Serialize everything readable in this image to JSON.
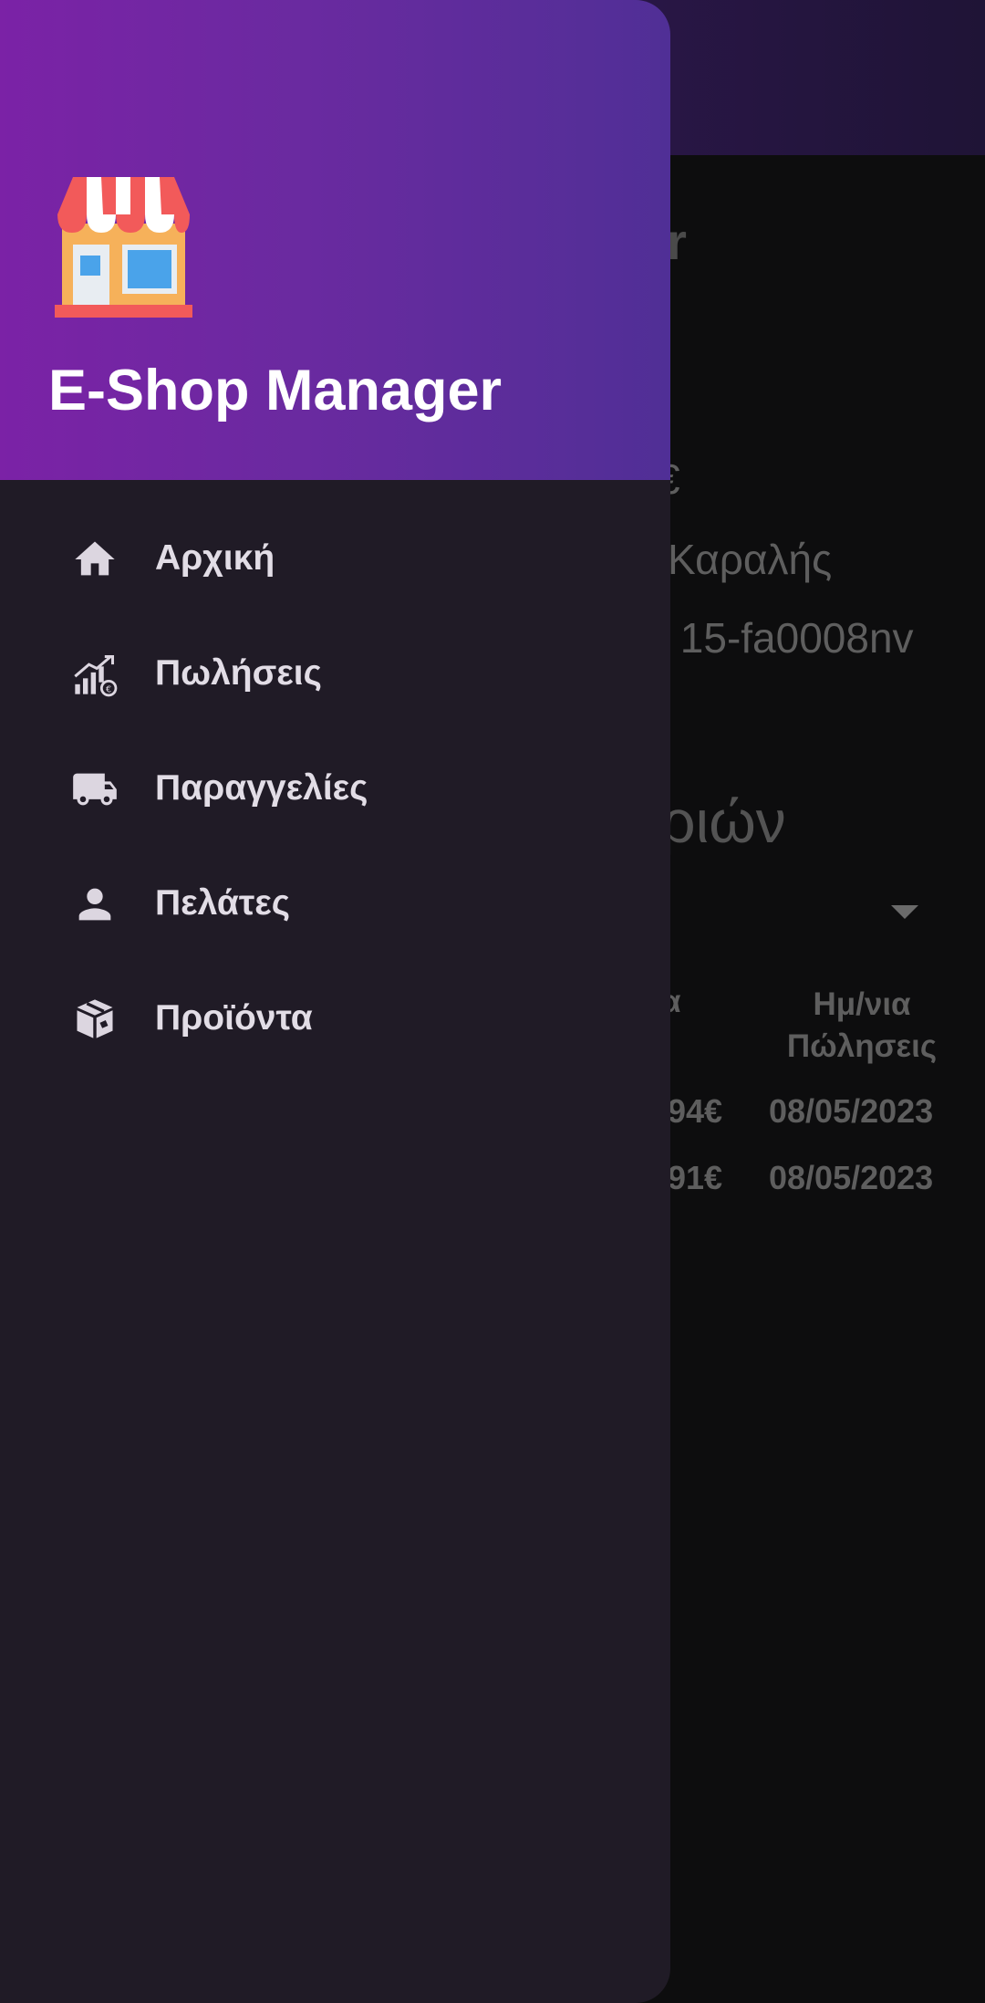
{
  "background": {
    "title_fragment": "er",
    "price_fragment": "€",
    "customer_fragment": "Καραλής",
    "product_fragment": "s 15-fa0008nv",
    "section_fragment": "ριών",
    "table": {
      "col_left_fragment": "α",
      "col_right": "Ημ/νια Πώλησεις",
      "rows": [
        {
          "value_fragment": "94€",
          "date": "08/05/2023"
        },
        {
          "value_fragment": "91€",
          "date": "08/05/2023"
        }
      ]
    }
  },
  "drawer": {
    "app_title": "E-Shop Manager",
    "logo_icon": "store-icon",
    "items": [
      {
        "label": "Αρχική",
        "icon": "home-icon"
      },
      {
        "label": "Πωλήσεις",
        "icon": "sales-chart-icon"
      },
      {
        "label": "Παραγγελίες",
        "icon": "truck-icon"
      },
      {
        "label": "Πελάτες",
        "icon": "person-icon"
      },
      {
        "label": "Προϊόντα",
        "icon": "box-icon"
      }
    ]
  },
  "colors": {
    "header_gradient_start": "#7b22a6",
    "header_gradient_end": "#502f96",
    "drawer_background": "#201b26",
    "nav_text": "#e2dde6"
  }
}
